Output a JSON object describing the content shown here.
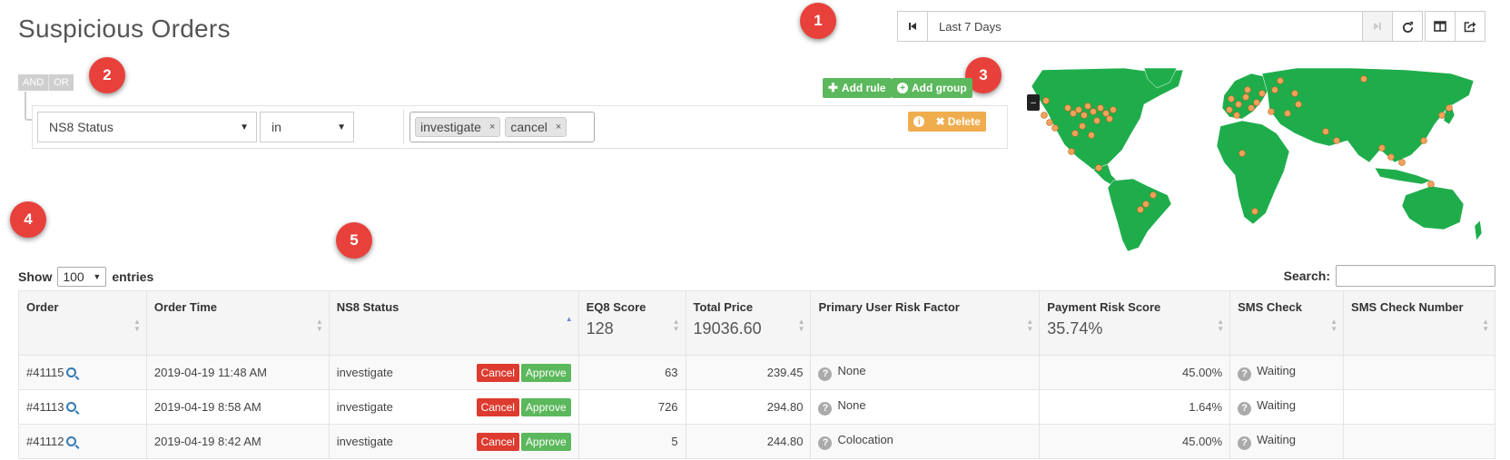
{
  "page": {
    "title": "Suspicious Orders"
  },
  "callouts": [
    "1",
    "2",
    "3",
    "4",
    "5"
  ],
  "daterange": {
    "label": "Last 7 Days",
    "icons": [
      "skip-back-icon",
      "skip-forward-icon",
      "refresh-icon",
      "columns-icon",
      "export-icon"
    ]
  },
  "query_builder": {
    "conditions": [
      "AND",
      "OR"
    ],
    "add_rule": "Add rule",
    "add_group": "Add group",
    "delete": "Delete",
    "rule": {
      "field": "NS8 Status",
      "operator": "in",
      "values": [
        "investigate",
        "cancel"
      ]
    }
  },
  "colors": {
    "map_land": "#1fad4c",
    "cancel": "#dd3b2f",
    "approve": "#5cb85c",
    "callout": "#e8413b"
  },
  "table_controls": {
    "show": "Show",
    "entries_value": "100",
    "entries": "entries",
    "search": "Search:"
  },
  "table": {
    "columns": [
      {
        "label": "Order",
        "sub": ""
      },
      {
        "label": "Order Time",
        "sub": ""
      },
      {
        "label": "NS8 Status",
        "sub": ""
      },
      {
        "label": "EQ8 Score",
        "sub": "128"
      },
      {
        "label": "Total Price",
        "sub": "19036.60"
      },
      {
        "label": "Primary User Risk Factor",
        "sub": ""
      },
      {
        "label": "Payment Risk Score",
        "sub": "35.74%"
      },
      {
        "label": "SMS Check",
        "sub": ""
      },
      {
        "label": "SMS Check Number",
        "sub": ""
      }
    ],
    "cancel_label": "Cancel",
    "approve_label": "Approve",
    "rows": [
      {
        "order": "#41115",
        "time": "2019-04-19 11:48 AM",
        "status": "investigate",
        "eq8": "63",
        "price": "239.45",
        "risk": "None",
        "payment": "45.00%",
        "sms": "Waiting",
        "sms_number": ""
      },
      {
        "order": "#41113",
        "time": "2019-04-19 8:58 AM",
        "status": "investigate",
        "eq8": "726",
        "price": "294.80",
        "risk": "None",
        "payment": "1.64%",
        "sms": "Waiting",
        "sms_number": ""
      },
      {
        "order": "#41112",
        "time": "2019-04-19 8:42 AM",
        "status": "investigate",
        "eq8": "5",
        "price": "244.80",
        "risk": "Colocation",
        "payment": "45.00%",
        "sms": "Waiting",
        "sms_number": ""
      }
    ]
  }
}
